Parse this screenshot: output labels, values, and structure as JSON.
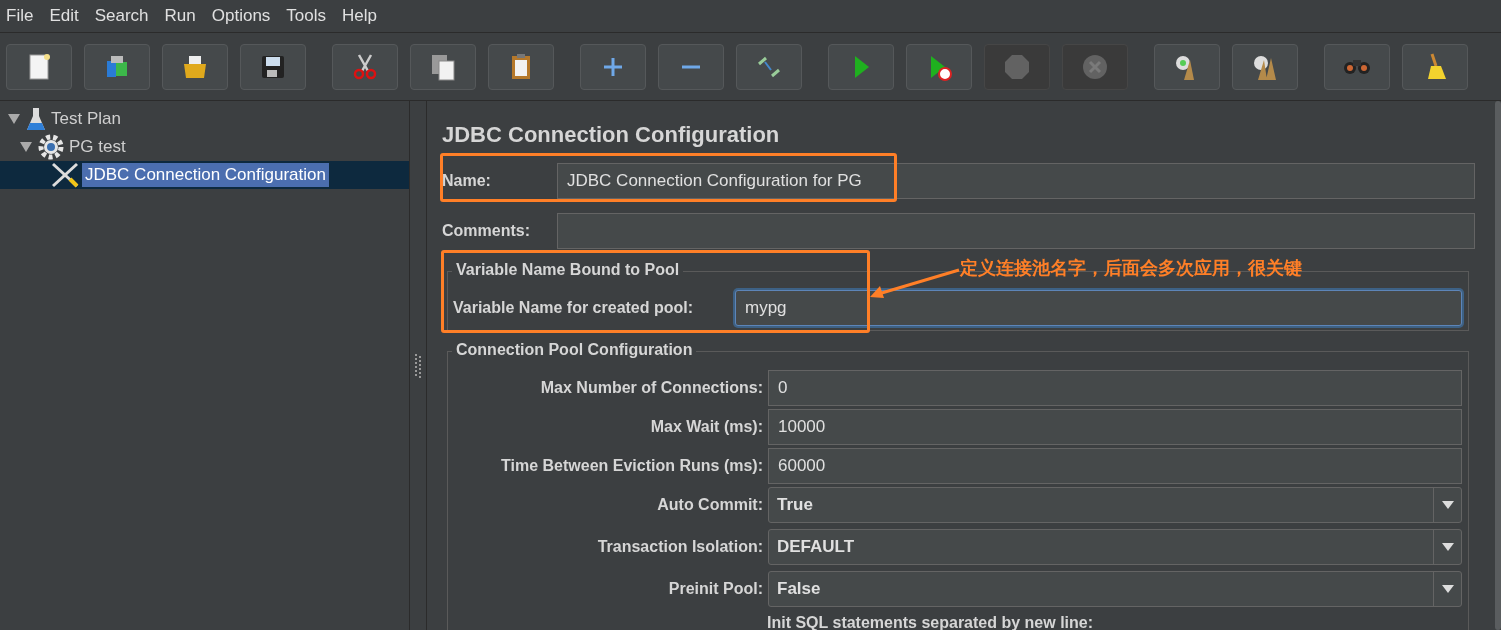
{
  "menu": [
    "File",
    "Edit",
    "Search",
    "Run",
    "Options",
    "Tools",
    "Help"
  ],
  "toolbar_groups": [
    [
      {
        "kind": "new",
        "disabled": false
      },
      {
        "kind": "templates",
        "disabled": false
      },
      {
        "kind": "open",
        "disabled": false
      },
      {
        "kind": "save",
        "disabled": false
      }
    ],
    [
      {
        "kind": "cut",
        "disabled": false
      },
      {
        "kind": "copy",
        "disabled": false
      },
      {
        "kind": "paste",
        "disabled": false
      }
    ],
    [
      {
        "kind": "expand",
        "disabled": false
      },
      {
        "kind": "collapse",
        "disabled": false
      },
      {
        "kind": "toggle",
        "disabled": false
      }
    ],
    [
      {
        "kind": "start",
        "disabled": false
      },
      {
        "kind": "start-no-pause",
        "disabled": false
      },
      {
        "kind": "stop",
        "disabled": true
      },
      {
        "kind": "shutdown",
        "disabled": true
      }
    ],
    [
      {
        "kind": "clear",
        "disabled": false
      },
      {
        "kind": "clear-all",
        "disabled": false
      }
    ],
    [
      {
        "kind": "search",
        "disabled": false
      },
      {
        "kind": "reset",
        "disabled": false
      }
    ]
  ],
  "tree": [
    {
      "label": "Test Plan",
      "kind": "plan",
      "expanded": true,
      "selected": false,
      "children": [
        {
          "label": "PG test",
          "kind": "group",
          "expanded": true,
          "selected": false,
          "children": [
            {
              "label": "JDBC Connection Configuration",
              "kind": "config",
              "selected": true
            }
          ]
        }
      ]
    }
  ],
  "panel": {
    "title": "JDBC Connection Configuration",
    "name": {
      "label": "Name:",
      "value": "JDBC Connection Configuration for PG"
    },
    "comments": {
      "label": "Comments:"
    },
    "variable_section": {
      "title": "Variable Name Bound to Pool",
      "label": "Variable Name for created pool:",
      "value": "mypg",
      "focused": true
    },
    "pool_section": {
      "title": "Connection Pool Configuration",
      "fields": [
        {
          "kind": "text",
          "label": "Max Number of Connections:",
          "value": "0"
        },
        {
          "kind": "text",
          "label": "Max Wait (ms):",
          "value": "10000"
        },
        {
          "kind": "text",
          "label": "Time Between Eviction Runs (ms):",
          "value": "60000"
        },
        {
          "kind": "select",
          "label": "Auto Commit:",
          "value": "True"
        },
        {
          "kind": "select",
          "label": "Transaction Isolation:",
          "value": "DEFAULT"
        },
        {
          "kind": "select",
          "label": "Preinit Pool:",
          "value": "False"
        },
        {
          "kind": "note",
          "label": "Init SQL statements separated by new line:"
        }
      ]
    }
  },
  "annotation": {
    "note": "定义连接池名字，后面会多次应用，很关键"
  }
}
